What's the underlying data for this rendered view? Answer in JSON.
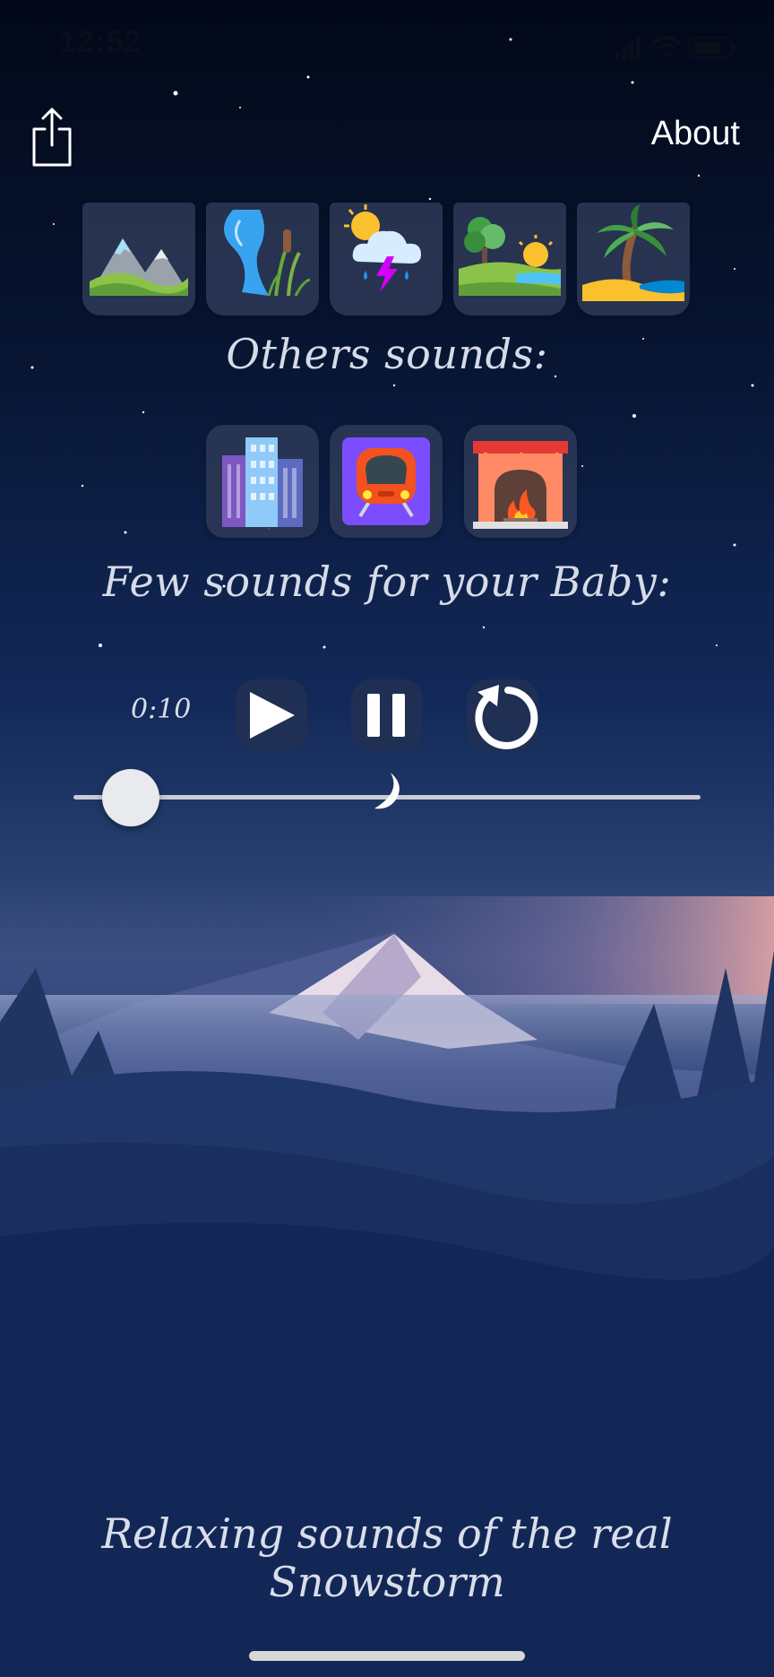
{
  "status_bar": {
    "time": "12:52",
    "icons": [
      "signal-icon",
      "wifi-icon",
      "battery-icon"
    ]
  },
  "header": {
    "share_icon": "share-icon",
    "about_label": "About"
  },
  "nature_sounds": [
    {
      "name": "mountain",
      "icon": "mountain-icon"
    },
    {
      "name": "river",
      "icon": "river-icon"
    },
    {
      "name": "thunderstorm",
      "icon": "thunderstorm-icon"
    },
    {
      "name": "countryside",
      "icon": "countryside-icon"
    },
    {
      "name": "beach",
      "icon": "beach-icon"
    }
  ],
  "others_title": "Others sounds:",
  "other_sounds": [
    {
      "name": "city",
      "icon": "city-icon"
    },
    {
      "name": "train",
      "icon": "train-icon"
    },
    {
      "name": "fireplace",
      "icon": "fireplace-icon"
    }
  ],
  "baby_title": "Few sounds for your Baby:",
  "player": {
    "time": "0:10",
    "play_icon": "play-icon",
    "pause_icon": "pause-icon",
    "replay_icon": "replay-icon",
    "slider_value": 0.05,
    "moon_icon": "crescent-moon-icon"
  },
  "footer_title": "Relaxing sounds of the real Snowstorm",
  "colors": {
    "sky_top": "#020818",
    "sky_mid": "#13295a",
    "tile_bg": "#2e3a58",
    "text": "#d5dbe8"
  }
}
